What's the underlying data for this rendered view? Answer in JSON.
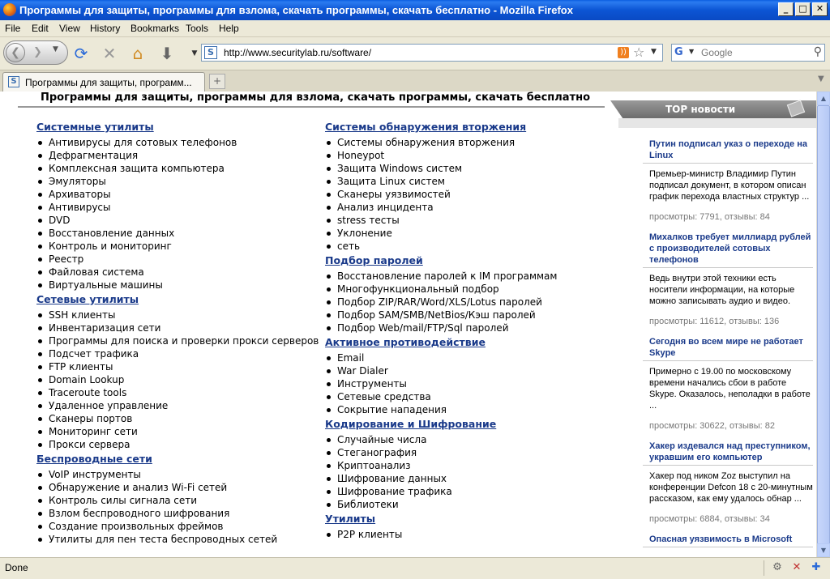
{
  "window": {
    "title": "Программы для защиты, программы для взлома, скачать программы, скачать бесплатно - Mozilla Firefox",
    "minimize": "_",
    "maximize": "□",
    "close": "✕"
  },
  "menu": [
    "File",
    "Edit",
    "View",
    "History",
    "Bookmarks",
    "Tools",
    "Help"
  ],
  "nav": {
    "url": "http://www.securitylab.ru/software/",
    "search_placeholder": "Google"
  },
  "tabs": [
    {
      "label": "Программы для защиты, программ...",
      "active": true
    }
  ],
  "page": {
    "heading": "Программы для защиты, программы для взлома, скачать программы, скачать бесплатно",
    "left_column": [
      {
        "title": "Системные утилиты",
        "items": [
          "Антивирусы для сотовых телефонов",
          "Дефрагментация",
          "Комплексная защита компьютера",
          "Эмуляторы",
          "Архиваторы",
          "Антивирусы",
          "DVD",
          "Восстановление данных",
          "Контроль и мониторинг",
          "Реестр",
          "Файловая система",
          "Виртуальные машины"
        ]
      },
      {
        "title": "Сетевые утилиты",
        "items": [
          "SSH клиенты",
          "Инвентаризация сети",
          "Программы для поиска и проверки прокси серверов",
          "Подсчет трафика",
          "FTP клиенты",
          "Domain Lookup",
          "Traceroute tools",
          "Удаленное управление",
          "Сканеры портов",
          "Мониторинг сети",
          "Прокси сервера"
        ]
      },
      {
        "title": "Беспроводные сети",
        "items": [
          "VoIP инструменты",
          "Обнаружение и анализ Wi-Fi сетей",
          "Контроль силы сигнала сети",
          "Взлом беспроводного шифрования",
          "Создание произвольных фреймов",
          "Утилиты для пен теста беспроводных сетей"
        ]
      }
    ],
    "right_column": [
      {
        "title": "Системы обнаружения вторжения",
        "items": [
          "Системы обнаружения вторжения",
          "Honeypot",
          "Защита Windows систем",
          "Защита Linux систем",
          "Сканеры уязвимостей",
          "Анализ инцидента",
          "stress тесты",
          "Уклонение",
          "сеть"
        ]
      },
      {
        "title": "Подбор паролей",
        "items": [
          "Восстановление паролей к IM программам",
          "Многофункциональный подбор",
          "Подбор ZIP/RAR/Word/XLS/Lotus паролей",
          "Подбор SAM/SMB/NetBios/Кэш паролей",
          "Подбор Web/mail/FTP/Sql паролей"
        ]
      },
      {
        "title": "Активное противодействие",
        "items": [
          "Email",
          "War Dialer",
          "Инструменты",
          "Сетевые средства",
          "Сокрытие нападения"
        ]
      },
      {
        "title": "Кодирование и Шифрование",
        "items": [
          "Случайные числа",
          "Стеганография",
          "Криптоанализ",
          "Шифрование данных",
          "Шифрование трафика",
          "Библиотеки"
        ]
      },
      {
        "title": "Утилиты",
        "items": [
          "P2P клиенты"
        ]
      }
    ]
  },
  "sidebar": {
    "header": "TOP новости",
    "news": [
      {
        "headline": "Путин подписал указ о переходе на Linux",
        "body": "Премьер-министр Владимир Путин подписал документ, в котором описан график перехода властных структур ...",
        "meta": "просмотры: 7791, отзывы: 84"
      },
      {
        "headline": "Михалков требует миллиард рублей с производителей сотовых телефонов",
        "body": "Ведь внутри этой техники есть носители информации, на которые можно записывать аудио и видео.",
        "meta": "просмотры: 11612, отзывы: 136"
      },
      {
        "headline": "Сегодня во всем мире не работает Skype",
        "body": "Примерно с 19.00 по московскому времени начались сбои в работе Skype. Оказалось, неполадки в работе ...",
        "meta": "просмотры: 30622, отзывы: 82"
      },
      {
        "headline": "Хакер издевался над преступником, укравшим его компьютер",
        "body": "Хакер под ником Zoz выступил на конференции Defcon 18 с 20-минутным рассказом, как ему удалось обнар ...",
        "meta": "просмотры: 6884, отзывы: 34"
      },
      {
        "headline": "Опасная уязвимость в Microsoft",
        "body": "",
        "meta": ""
      }
    ]
  },
  "status": {
    "text": "Done"
  }
}
